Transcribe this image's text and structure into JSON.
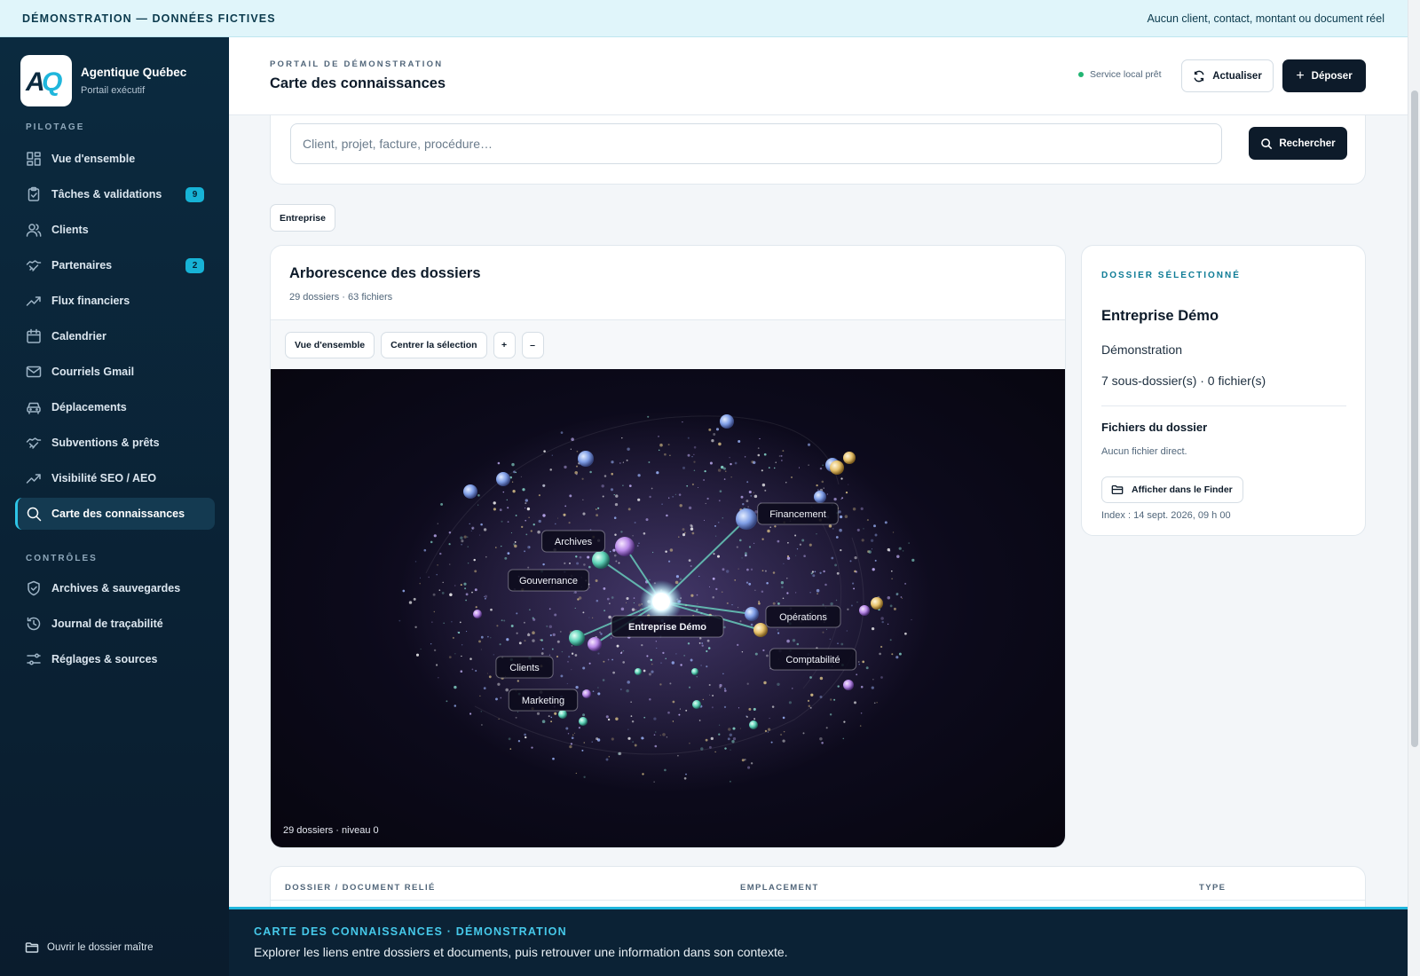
{
  "banner": {
    "left": "DÉMONSTRATION — DONNÉES FICTIVES",
    "right": "Aucun client, contact, montant ou document réel"
  },
  "brand": {
    "logo_text": "AQ",
    "name": "Agentique Québec",
    "subtitle": "Portail exécutif"
  },
  "nav": {
    "section_pilotage": "PILOTAGE",
    "section_controles": "CONTRÔLES",
    "items": [
      {
        "label": "Vue d'ensemble",
        "icon": "dashboard-icon"
      },
      {
        "label": "Tâches & validations",
        "icon": "clipboard-icon",
        "badge": "9"
      },
      {
        "label": "Clients",
        "icon": "users-icon"
      },
      {
        "label": "Partenaires",
        "icon": "handshake-icon",
        "badge": "2"
      },
      {
        "label": "Flux financiers",
        "icon": "trend-icon"
      },
      {
        "label": "Calendrier",
        "icon": "calendar-icon"
      },
      {
        "label": "Courriels Gmail",
        "icon": "mail-icon"
      },
      {
        "label": "Déplacements",
        "icon": "car-icon"
      },
      {
        "label": "Subventions & prêts",
        "icon": "handshake-icon"
      },
      {
        "label": "Visibilité SEO / AEO",
        "icon": "trend-icon"
      },
      {
        "label": "Carte des connaissances",
        "icon": "search-icon",
        "active": true
      },
      {
        "label": "Archives & sauvegardes",
        "icon": "shield-icon"
      },
      {
        "label": "Journal de traçabilité",
        "icon": "history-icon"
      },
      {
        "label": "Réglages & sources",
        "icon": "sliders-icon"
      }
    ],
    "footer": "Ouvrir le dossier maître"
  },
  "header": {
    "eyebrow": "PORTAIL DE DÉMONSTRATION",
    "title": "Carte des connaissances",
    "status": "Service local prêt",
    "refresh_label": "Actualiser",
    "deposit_label": "Déposer"
  },
  "search": {
    "placeholder": "Client, projet, facture, procédure…",
    "value": "",
    "button_label": "Rechercher"
  },
  "filter_chip": "Entreprise",
  "graph": {
    "title": "Arborescence des dossiers",
    "subtitle": "29 dossiers · 63 fichiers",
    "tools": {
      "overview": "Vue d'ensemble",
      "center": "Centrer la sélection",
      "zoom_in": "+",
      "zoom_out": "–"
    },
    "footer": "29 dossiers · niveau 0",
    "center_node": "Entreprise Démo",
    "nodes": [
      "Financement",
      "Archives",
      "Gouvernance",
      "Opérations",
      "Comptabilité",
      "Clients",
      "Marketing"
    ]
  },
  "detail": {
    "eyebrow": "DOSSIER SÉLECTIONNÉ",
    "title": "Entreprise Démo",
    "type": "Démonstration",
    "counts": "7 sous-dossier(s) · 0 fichier(s)",
    "files_heading": "Fichiers du dossier",
    "files_empty": "Aucun fichier direct.",
    "finder_label": "Afficher dans le Finder",
    "index": "Index : 14 sept. 2026, 09 h 00"
  },
  "table": {
    "columns": [
      "DOSSIER / DOCUMENT RELIÉ",
      "EMPLACEMENT",
      "TYPE"
    ]
  },
  "bottom_banner": {
    "title": "CARTE DES CONNAISSANCES · DÉMONSTRATION",
    "text": "Explorer les liens entre dossiers et documents, puis retrouver une information dans son contexte."
  }
}
